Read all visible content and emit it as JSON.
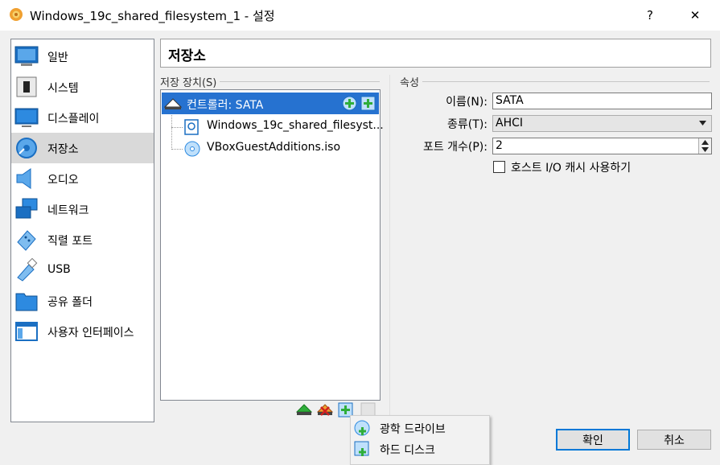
{
  "window": {
    "title": "Windows_19c_shared_filesystem_1 - 설정",
    "help_label": "?",
    "close_label": "✕"
  },
  "sidebar": {
    "items": [
      {
        "label": "일반",
        "icon": "monitor-icon"
      },
      {
        "label": "시스템",
        "icon": "chip-icon"
      },
      {
        "label": "디스플레이",
        "icon": "display-icon"
      },
      {
        "label": "저장소",
        "icon": "disk-icon"
      },
      {
        "label": "오디오",
        "icon": "speaker-icon"
      },
      {
        "label": "네트워크",
        "icon": "network-icon"
      },
      {
        "label": "직렬 포트",
        "icon": "serial-port-icon"
      },
      {
        "label": "USB",
        "icon": "usb-icon"
      },
      {
        "label": "공유 폴더",
        "icon": "folder-icon"
      },
      {
        "label": "사용자 인터페이스",
        "icon": "window-icon"
      }
    ],
    "selected_index": 3
  },
  "page": {
    "title": "저장소"
  },
  "storage": {
    "group_label": "저장 장치(S)",
    "controller_label": "컨트롤러: SATA",
    "devices": [
      {
        "label": "Windows_19c_shared_filesyst...",
        "icon": "hard-disk-icon"
      },
      {
        "label": "VBoxGuestAdditions.iso",
        "icon": "optical-disc-icon"
      }
    ]
  },
  "attributes": {
    "group_label": "속성",
    "name_label": "이름(N):",
    "name_value": "SATA",
    "type_label": "종류(T):",
    "type_value": "AHCI",
    "ports_label": "포트 개수(P):",
    "ports_value": "2",
    "cache_label": "호스트 I/O 캐시 사용하기",
    "cache_checked": false
  },
  "popup_menu": {
    "items": [
      {
        "label": "광학 드라이브",
        "icon": "optical-drive-add-icon"
      },
      {
        "label": "하드 디스크",
        "icon": "hard-disk-add-icon"
      }
    ]
  },
  "buttons": {
    "ok_label": "확인",
    "cancel_label": "취소"
  },
  "colors": {
    "selection": "#2672d0",
    "accent": "#0078d7"
  }
}
